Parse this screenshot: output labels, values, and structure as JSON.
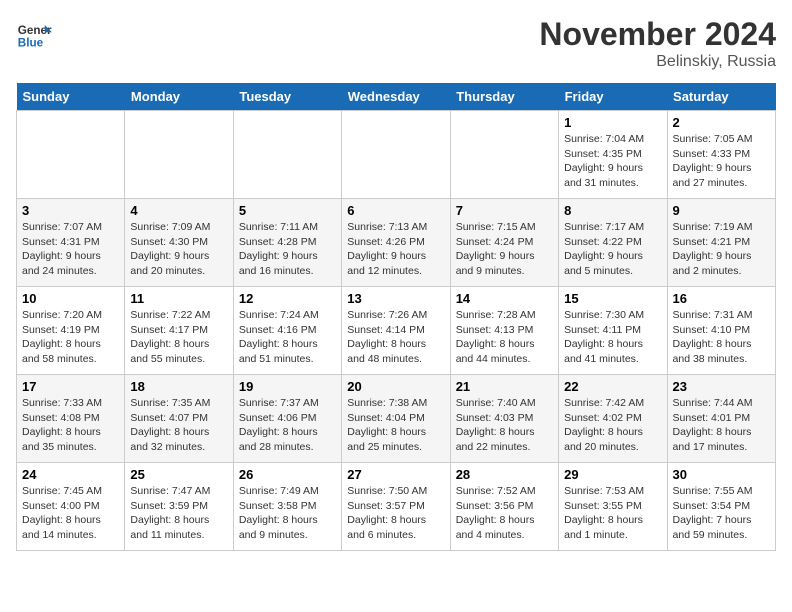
{
  "logo": {
    "line1": "General",
    "line2": "Blue"
  },
  "title": "November 2024",
  "location": "Belinskiy, Russia",
  "days_of_week": [
    "Sunday",
    "Monday",
    "Tuesday",
    "Wednesday",
    "Thursday",
    "Friday",
    "Saturday"
  ],
  "weeks": [
    [
      {
        "day": "",
        "info": ""
      },
      {
        "day": "",
        "info": ""
      },
      {
        "day": "",
        "info": ""
      },
      {
        "day": "",
        "info": ""
      },
      {
        "day": "",
        "info": ""
      },
      {
        "day": "1",
        "info": "Sunrise: 7:04 AM\nSunset: 4:35 PM\nDaylight: 9 hours and 31 minutes."
      },
      {
        "day": "2",
        "info": "Sunrise: 7:05 AM\nSunset: 4:33 PM\nDaylight: 9 hours and 27 minutes."
      }
    ],
    [
      {
        "day": "3",
        "info": "Sunrise: 7:07 AM\nSunset: 4:31 PM\nDaylight: 9 hours and 24 minutes."
      },
      {
        "day": "4",
        "info": "Sunrise: 7:09 AM\nSunset: 4:30 PM\nDaylight: 9 hours and 20 minutes."
      },
      {
        "day": "5",
        "info": "Sunrise: 7:11 AM\nSunset: 4:28 PM\nDaylight: 9 hours and 16 minutes."
      },
      {
        "day": "6",
        "info": "Sunrise: 7:13 AM\nSunset: 4:26 PM\nDaylight: 9 hours and 12 minutes."
      },
      {
        "day": "7",
        "info": "Sunrise: 7:15 AM\nSunset: 4:24 PM\nDaylight: 9 hours and 9 minutes."
      },
      {
        "day": "8",
        "info": "Sunrise: 7:17 AM\nSunset: 4:22 PM\nDaylight: 9 hours and 5 minutes."
      },
      {
        "day": "9",
        "info": "Sunrise: 7:19 AM\nSunset: 4:21 PM\nDaylight: 9 hours and 2 minutes."
      }
    ],
    [
      {
        "day": "10",
        "info": "Sunrise: 7:20 AM\nSunset: 4:19 PM\nDaylight: 8 hours and 58 minutes."
      },
      {
        "day": "11",
        "info": "Sunrise: 7:22 AM\nSunset: 4:17 PM\nDaylight: 8 hours and 55 minutes."
      },
      {
        "day": "12",
        "info": "Sunrise: 7:24 AM\nSunset: 4:16 PM\nDaylight: 8 hours and 51 minutes."
      },
      {
        "day": "13",
        "info": "Sunrise: 7:26 AM\nSunset: 4:14 PM\nDaylight: 8 hours and 48 minutes."
      },
      {
        "day": "14",
        "info": "Sunrise: 7:28 AM\nSunset: 4:13 PM\nDaylight: 8 hours and 44 minutes."
      },
      {
        "day": "15",
        "info": "Sunrise: 7:30 AM\nSunset: 4:11 PM\nDaylight: 8 hours and 41 minutes."
      },
      {
        "day": "16",
        "info": "Sunrise: 7:31 AM\nSunset: 4:10 PM\nDaylight: 8 hours and 38 minutes."
      }
    ],
    [
      {
        "day": "17",
        "info": "Sunrise: 7:33 AM\nSunset: 4:08 PM\nDaylight: 8 hours and 35 minutes."
      },
      {
        "day": "18",
        "info": "Sunrise: 7:35 AM\nSunset: 4:07 PM\nDaylight: 8 hours and 32 minutes."
      },
      {
        "day": "19",
        "info": "Sunrise: 7:37 AM\nSunset: 4:06 PM\nDaylight: 8 hours and 28 minutes."
      },
      {
        "day": "20",
        "info": "Sunrise: 7:38 AM\nSunset: 4:04 PM\nDaylight: 8 hours and 25 minutes."
      },
      {
        "day": "21",
        "info": "Sunrise: 7:40 AM\nSunset: 4:03 PM\nDaylight: 8 hours and 22 minutes."
      },
      {
        "day": "22",
        "info": "Sunrise: 7:42 AM\nSunset: 4:02 PM\nDaylight: 8 hours and 20 minutes."
      },
      {
        "day": "23",
        "info": "Sunrise: 7:44 AM\nSunset: 4:01 PM\nDaylight: 8 hours and 17 minutes."
      }
    ],
    [
      {
        "day": "24",
        "info": "Sunrise: 7:45 AM\nSunset: 4:00 PM\nDaylight: 8 hours and 14 minutes."
      },
      {
        "day": "25",
        "info": "Sunrise: 7:47 AM\nSunset: 3:59 PM\nDaylight: 8 hours and 11 minutes."
      },
      {
        "day": "26",
        "info": "Sunrise: 7:49 AM\nSunset: 3:58 PM\nDaylight: 8 hours and 9 minutes."
      },
      {
        "day": "27",
        "info": "Sunrise: 7:50 AM\nSunset: 3:57 PM\nDaylight: 8 hours and 6 minutes."
      },
      {
        "day": "28",
        "info": "Sunrise: 7:52 AM\nSunset: 3:56 PM\nDaylight: 8 hours and 4 minutes."
      },
      {
        "day": "29",
        "info": "Sunrise: 7:53 AM\nSunset: 3:55 PM\nDaylight: 8 hours and 1 minute."
      },
      {
        "day": "30",
        "info": "Sunrise: 7:55 AM\nSunset: 3:54 PM\nDaylight: 7 hours and 59 minutes."
      }
    ]
  ]
}
